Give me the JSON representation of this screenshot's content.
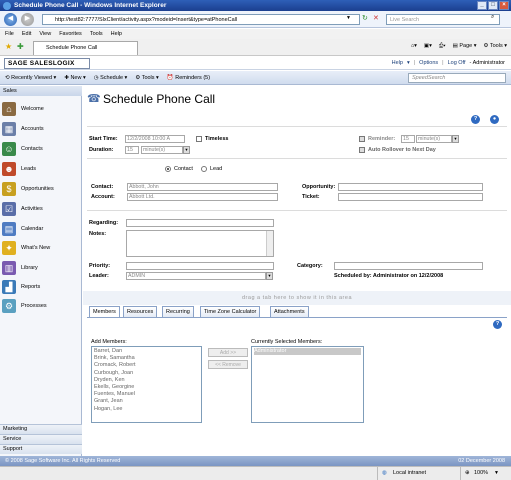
{
  "window": {
    "title": "Schedule Phone Call - Windows Internet Explorer"
  },
  "addressbar": {
    "url": "http://test82:7777/SlxClient/activity.aspx?modeid=Insert&type=atPhoneCall",
    "search_placeholder": "Live Search"
  },
  "menubar": {
    "items": [
      "File",
      "Edit",
      "View",
      "Favorites",
      "Tools",
      "Help"
    ]
  },
  "favbar": {
    "tab_label": "Schedule Phone Call",
    "page_label": "Page",
    "tools_label": "Tools"
  },
  "sage": {
    "logo": "SAGE SALESLOGIX",
    "links": [
      "Help",
      "Options",
      "Log Off",
      "- Administrator"
    ]
  },
  "apptoolbar": {
    "items": [
      "Recently Viewed",
      "New",
      "Schedule",
      "Tools",
      "Reminders (5)"
    ],
    "speedsearch_placeholder": "SpeedSearch"
  },
  "sidebar": {
    "header": "Sales",
    "items": [
      "Welcome",
      "Accounts",
      "Contacts",
      "Leads",
      "Opportunities",
      "Activities",
      "Calendar",
      "What's New",
      "Library",
      "Reports",
      "Processes"
    ],
    "footer": [
      "Marketing",
      "Service",
      "Support"
    ]
  },
  "form": {
    "title": "Schedule Phone Call",
    "start_time_label": "Start Time:",
    "start_time_value": "12/2/2008 10:00 A",
    "timeless_label": "Timeless",
    "duration_label": "Duration:",
    "duration_value": "15",
    "duration_unit": "minute(s)",
    "reminder_label": "Reminder:",
    "reminder_value": "15",
    "reminder_unit": "minute(s)",
    "auto_rollover_label": "Auto Rollover to Next Day",
    "contact_option": "Contact",
    "lead_option": "Lead",
    "contact_label": "Contact:",
    "contact_value": "Abbott, John",
    "account_label": "Account:",
    "account_value": "Abbott Ltd.",
    "opportunity_label": "Opportunity:",
    "ticket_label": "Ticket:",
    "regarding_label": "Regarding:",
    "notes_label": "Notes:",
    "priority_label": "Priority:",
    "leader_label": "Leader:",
    "leader_value": "ADMIN",
    "category_label": "Category:",
    "scheduled_by": "Scheduled by: Administrator on 12/2/2008"
  },
  "tabs": {
    "drag_hint": "drag a tab here to show it in this area",
    "items": [
      "Members",
      "Resources",
      "Recurring",
      "Time Zone Calculator",
      "Attachments"
    ]
  },
  "members": {
    "add_label": "Add Members:",
    "add_list": [
      "Barret, Dan",
      "Brink, Samantha",
      "Cromack, Robert",
      "Curbough, Joan",
      "Dryden, Ken",
      "Ekells, Georgine",
      "Fuentes, Manuel",
      "Grant, Jean",
      "Hogan, Lee"
    ],
    "add_button": "Add >>",
    "remove_button": "<< Remove",
    "selected_label": "Currently Selected Members:",
    "selected_list": [
      "Administrator"
    ]
  },
  "footer": {
    "copyright": "© 2008 Sage Software Inc. All Rights Reserved",
    "date": "02 December 2008"
  },
  "statusbar": {
    "zone": "Local intranet",
    "zoom": "100%"
  }
}
